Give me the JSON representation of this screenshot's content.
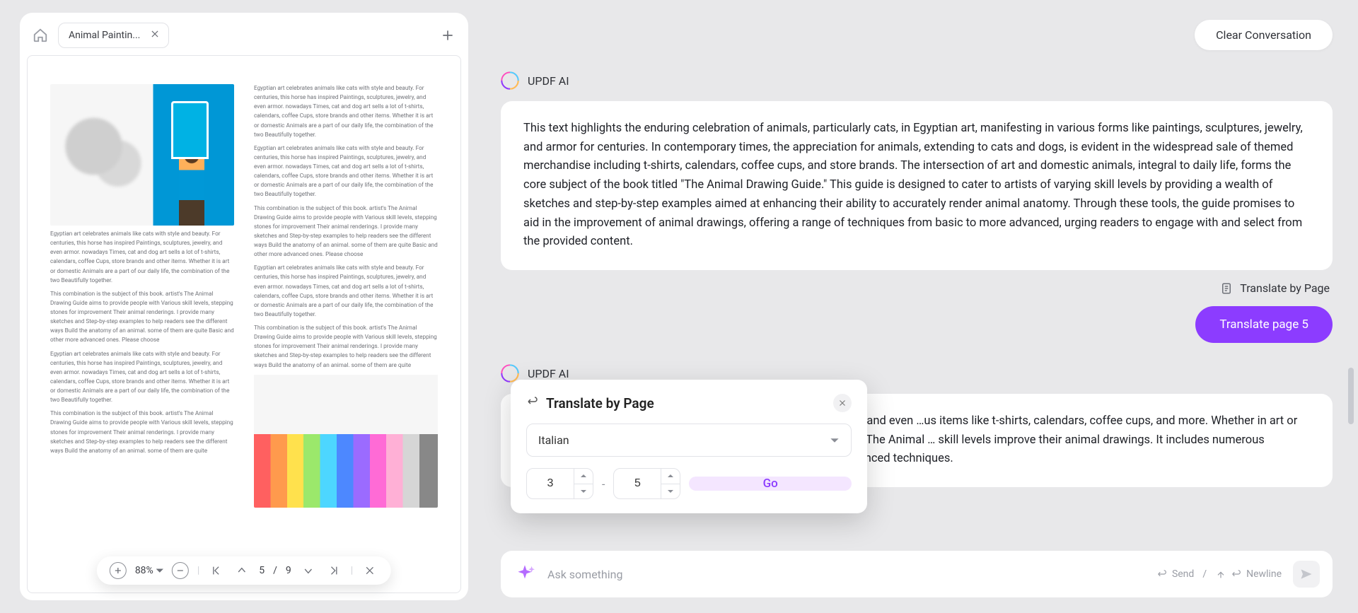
{
  "tab": {
    "filename": "Animal Paintin..."
  },
  "toolbar": {
    "zoom": "88%",
    "page_current": "5",
    "page_sep": "/",
    "page_total": "9"
  },
  "doc_text": {
    "p1": "Egyptian art celebrates animals like cats with style and beauty. For centuries, this horse has inspired Paintings, sculptures, jewelry, and even armor. nowadays Times, cat and dog art sells a lot of t-shirts, calendars, coffee Cups, store brands and other items. Whether it is art or domestic Animals are a part of our daily life, the combination of the two Beautifully together.",
    "p2": "Egyptian art celebrates animals like cats with style and beauty. For centuries, this horse has inspired Paintings, sculptures, jewelry, and even armor. nowadays Times, cat and dog art sells a lot of t-shirts, calendars, coffee Cups, store brands and other items. Whether it is art or domestic Animals are a part of our daily life, the combination of the two Beautifully together.",
    "p3": "This combination is the subject of this book. artist's The Animal Drawing Guide aims to provide people with Various skill levels, stepping stones for improvement Their animal renderings. I provide many sketches and Step-by-step examples to help readers see the different ways Build the anatomy of an animal. some of them are quite Basic and other more advanced ones. Please choose",
    "p4": "Egyptian art celebrates animals like cats with style and beauty. For centuries, this horse has inspired Paintings, sculptures, jewelry, and even armor. nowadays Times, cat and dog art sells a lot of t-shirts, calendars, coffee Cups, store brands and other items. Whether it is art or domestic Animals are a part of our daily life, the combination of the two Beautifully together.",
    "p5": "This combination is the subject of this book. artist's The Animal Drawing Guide aims to provide people with Various skill levels, stepping stones for improvement Their animal renderings. I provide many sketches and Step-by-step examples to help readers see the different ways Build the anatomy of an animal. some of them are quite"
  },
  "header": {
    "clear": "Clear Conversation"
  },
  "ai": {
    "label": "UPDF AI"
  },
  "bubble1": "This text highlights the enduring celebration of animals, particularly cats, in Egyptian art, manifesting in various forms like paintings, sculptures, jewelry, and armor for centuries. In contemporary times, the appreciation for animals, extending to cats and dogs, is evident in the widespread sale of themed merchandise including t-shirts, calendars, coffee cups, and store brands. The intersection of art and domestic animals, integral to daily life, forms the core subject of the book titled \"The Animal Drawing Guide.\" This guide is designed to cater to artists of varying skill levels by providing a wealth of sketches and step-by-step examples aimed at enhancing their ability to accurately render animal anatomy. Through these tools, the guide promises to aid in the improvement of animal drawings, offering a range of techniques from basic to more advanced, urging readers to engage with and select from the provided content.",
  "translate_row": {
    "label": "Translate by Page"
  },
  "translate_btn": "Translate page 5",
  "bubble2": "…uty. For centuries, this has inspired paintings, sculptures, jewelry, and even …us items like t-shirts, calendars, coffee cups, and more. Whether in art or as …es. This book focuses on the combination of art and animals. The Animal … skill levels improve their animal drawings. It includes numerous sketches and …he anatomy of animals, ranging from basic to advanced techniques.",
  "popover": {
    "title": "Translate by Page",
    "language": "Italian",
    "from": "3",
    "to": "5",
    "dash": "-",
    "go": "Go"
  },
  "prompt": {
    "placeholder": "Ask something",
    "send": "Send",
    "newline": "Newline",
    "sep": "/"
  }
}
